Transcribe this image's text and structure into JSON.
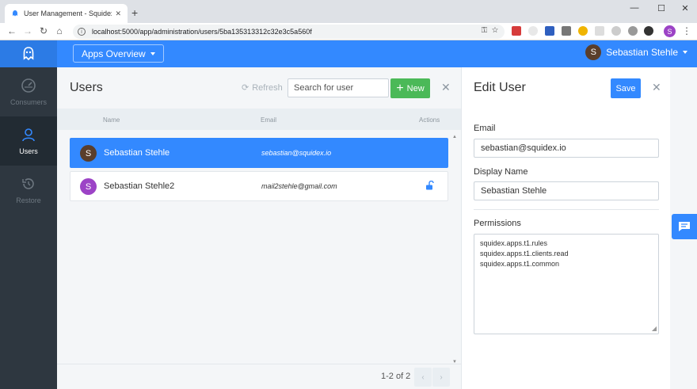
{
  "browser": {
    "tab_title": "User Management - Squidex Hea",
    "tab_close": "✕",
    "new_tab": "+",
    "url": "localhost:5000/app/administration/users/5ba135313312c32e3c5a560f",
    "profile_initial": "S",
    "window_controls": [
      "—",
      "☐",
      "✕"
    ]
  },
  "header": {
    "apps_button_label": "Apps Overview",
    "user_name": "Sebastian Stehle",
    "user_initial": "S",
    "colors": {
      "primary": "#3389ff"
    }
  },
  "sidebar": {
    "items": [
      {
        "label": "Consumers",
        "icon": "gauge-icon",
        "active": false
      },
      {
        "label": "Users",
        "icon": "user-icon",
        "active": true
      },
      {
        "label": "Restore",
        "icon": "restore-icon",
        "active": false
      }
    ]
  },
  "users": {
    "title": "Users",
    "refresh_label": "Refresh",
    "search_placeholder": "Search for user",
    "new_button_label": "New",
    "close_label": "✕",
    "columns": {
      "name": "Name",
      "email": "Email",
      "actions": "Actions"
    },
    "rows": [
      {
        "initial": "S",
        "name": "Sebastian Stehle",
        "email": "sebastian@squidex.io",
        "selected": true,
        "avatar_color": "#5a3e2b"
      },
      {
        "initial": "S",
        "name": "Sebastian Stehle2",
        "email": "mail2stehle@gmail.com",
        "selected": false,
        "avatar_color": "#9c43c6"
      }
    ],
    "pager_info": "1-2 of 2",
    "pager_prev": "‹",
    "pager_next": "›"
  },
  "edit_user": {
    "title": "Edit User",
    "save_label": "Save",
    "close_label": "✕",
    "email_label": "Email",
    "email_value": "sebastian@squidex.io",
    "display_name_label": "Display Name",
    "display_name_value": "Sebastian Stehle",
    "permissions_label": "Permissions",
    "permissions": [
      "squidex.apps.t1.rules",
      "squidex.apps.t1.clients.read",
      "squidex.apps.t1.common"
    ]
  }
}
